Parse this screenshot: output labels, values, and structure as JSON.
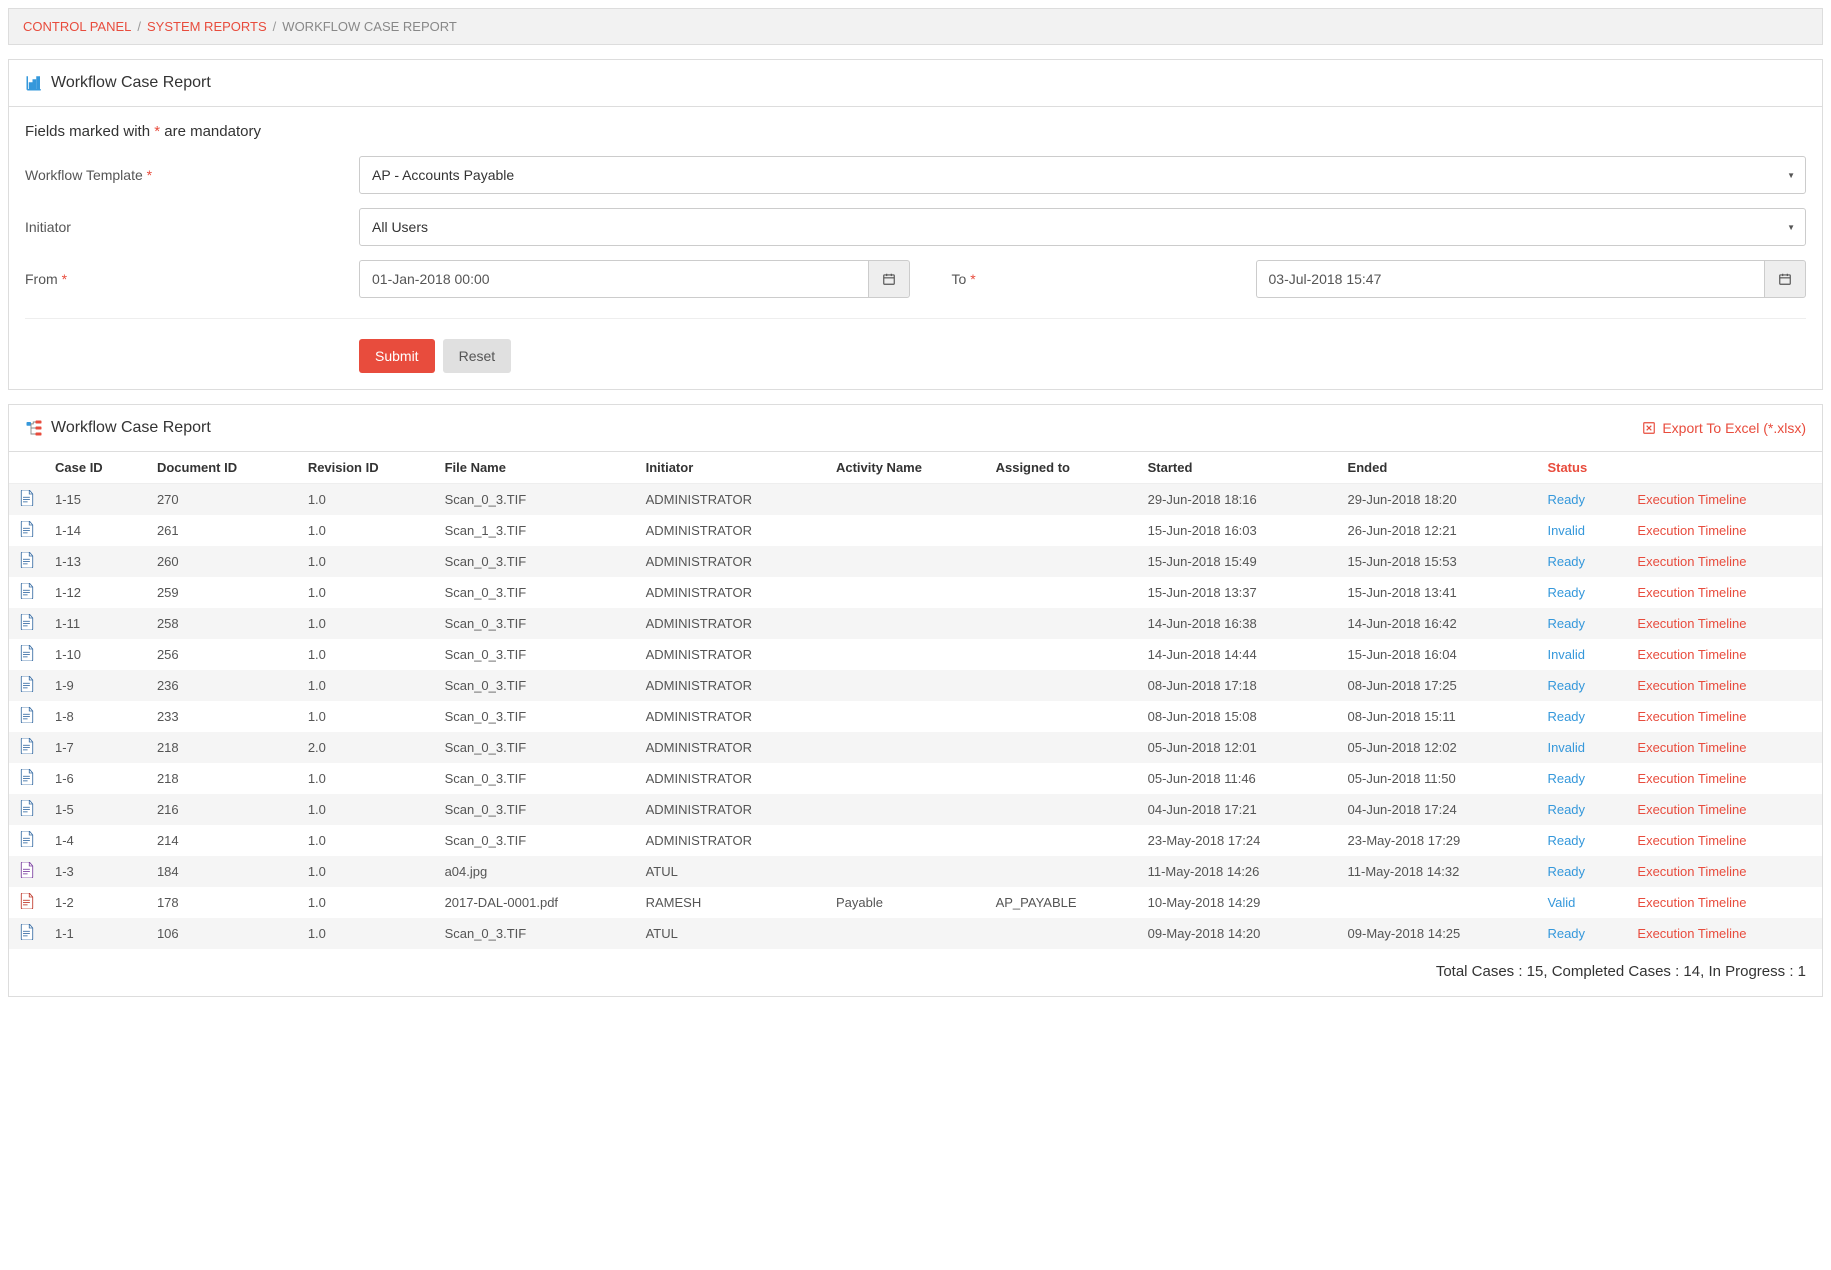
{
  "breadcrumb": {
    "items": [
      {
        "label": "CONTROL PANEL",
        "link": true
      },
      {
        "label": "SYSTEM REPORTS",
        "link": true
      },
      {
        "label": "WORKFLOW CASE REPORT",
        "link": false
      }
    ]
  },
  "form_panel": {
    "title": "Workflow Case Report",
    "mandatory_prefix": "Fields marked with ",
    "mandatory_star": "*",
    "mandatory_suffix": " are mandatory",
    "template_label": "Workflow Template ",
    "template_value": "AP - Accounts Payable",
    "initiator_label": "Initiator",
    "initiator_value": "All Users",
    "from_label": "From ",
    "from_value": "01-Jan-2018 00:00",
    "to_label": "To ",
    "to_value": "03-Jul-2018 15:47",
    "submit": "Submit",
    "reset": "Reset"
  },
  "results_panel": {
    "title": "Workflow Case Report",
    "export_label": "Export To Excel (*.xlsx)",
    "columns": [
      "",
      "Case ID",
      "Document ID",
      "Revision ID",
      "File Name",
      "Initiator",
      "Activity Name",
      "Assigned to",
      "Started",
      "Ended",
      "Status",
      ""
    ],
    "timeline_label": "Execution Timeline",
    "rows": [
      {
        "icon": "doc",
        "case_id": "1-15",
        "doc_id": "270",
        "rev_id": "1.0",
        "file": "Scan_0_3.TIF",
        "initiator": "ADMINISTRATOR",
        "activity": "",
        "assigned": "",
        "started": "29-Jun-2018 18:16",
        "ended": "29-Jun-2018 18:20",
        "status": "Ready"
      },
      {
        "icon": "doc",
        "case_id": "1-14",
        "doc_id": "261",
        "rev_id": "1.0",
        "file": "Scan_1_3.TIF",
        "initiator": "ADMINISTRATOR",
        "activity": "",
        "assigned": "",
        "started": "15-Jun-2018 16:03",
        "ended": "26-Jun-2018 12:21",
        "status": "Invalid"
      },
      {
        "icon": "doc",
        "case_id": "1-13",
        "doc_id": "260",
        "rev_id": "1.0",
        "file": "Scan_0_3.TIF",
        "initiator": "ADMINISTRATOR",
        "activity": "",
        "assigned": "",
        "started": "15-Jun-2018 15:49",
        "ended": "15-Jun-2018 15:53",
        "status": "Ready"
      },
      {
        "icon": "doc",
        "case_id": "1-12",
        "doc_id": "259",
        "rev_id": "1.0",
        "file": "Scan_0_3.TIF",
        "initiator": "ADMINISTRATOR",
        "activity": "",
        "assigned": "",
        "started": "15-Jun-2018 13:37",
        "ended": "15-Jun-2018 13:41",
        "status": "Ready"
      },
      {
        "icon": "doc",
        "case_id": "1-11",
        "doc_id": "258",
        "rev_id": "1.0",
        "file": "Scan_0_3.TIF",
        "initiator": "ADMINISTRATOR",
        "activity": "",
        "assigned": "",
        "started": "14-Jun-2018 16:38",
        "ended": "14-Jun-2018 16:42",
        "status": "Ready"
      },
      {
        "icon": "doc",
        "case_id": "1-10",
        "doc_id": "256",
        "rev_id": "1.0",
        "file": "Scan_0_3.TIF",
        "initiator": "ADMINISTRATOR",
        "activity": "",
        "assigned": "",
        "started": "14-Jun-2018 14:44",
        "ended": "15-Jun-2018 16:04",
        "status": "Invalid"
      },
      {
        "icon": "doc",
        "case_id": "1-9",
        "doc_id": "236",
        "rev_id": "1.0",
        "file": "Scan_0_3.TIF",
        "initiator": "ADMINISTRATOR",
        "activity": "",
        "assigned": "",
        "started": "08-Jun-2018 17:18",
        "ended": "08-Jun-2018 17:25",
        "status": "Ready"
      },
      {
        "icon": "doc",
        "case_id": "1-8",
        "doc_id": "233",
        "rev_id": "1.0",
        "file": "Scan_0_3.TIF",
        "initiator": "ADMINISTRATOR",
        "activity": "",
        "assigned": "",
        "started": "08-Jun-2018 15:08",
        "ended": "08-Jun-2018 15:11",
        "status": "Ready"
      },
      {
        "icon": "doc",
        "case_id": "1-7",
        "doc_id": "218",
        "rev_id": "2.0",
        "file": "Scan_0_3.TIF",
        "initiator": "ADMINISTRATOR",
        "activity": "",
        "assigned": "",
        "started": "05-Jun-2018 12:01",
        "ended": "05-Jun-2018 12:02",
        "status": "Invalid"
      },
      {
        "icon": "doc",
        "case_id": "1-6",
        "doc_id": "218",
        "rev_id": "1.0",
        "file": "Scan_0_3.TIF",
        "initiator": "ADMINISTRATOR",
        "activity": "",
        "assigned": "",
        "started": "05-Jun-2018 11:46",
        "ended": "05-Jun-2018 11:50",
        "status": "Ready"
      },
      {
        "icon": "doc",
        "case_id": "1-5",
        "doc_id": "216",
        "rev_id": "1.0",
        "file": "Scan_0_3.TIF",
        "initiator": "ADMINISTRATOR",
        "activity": "",
        "assigned": "",
        "started": "04-Jun-2018 17:21",
        "ended": "04-Jun-2018 17:24",
        "status": "Ready"
      },
      {
        "icon": "doc",
        "case_id": "1-4",
        "doc_id": "214",
        "rev_id": "1.0",
        "file": "Scan_0_3.TIF",
        "initiator": "ADMINISTRATOR",
        "activity": "",
        "assigned": "",
        "started": "23-May-2018 17:24",
        "ended": "23-May-2018 17:29",
        "status": "Ready"
      },
      {
        "icon": "img",
        "case_id": "1-3",
        "doc_id": "184",
        "rev_id": "1.0",
        "file": "a04.jpg",
        "initiator": "ATUL",
        "activity": "",
        "assigned": "",
        "started": "11-May-2018 14:26",
        "ended": "11-May-2018 14:32",
        "status": "Ready"
      },
      {
        "icon": "pdf",
        "case_id": "1-2",
        "doc_id": "178",
        "rev_id": "1.0",
        "file": "2017-DAL-0001.pdf",
        "initiator": "RAMESH",
        "activity": "Payable",
        "assigned": "AP_PAYABLE",
        "started": "10-May-2018 14:29",
        "ended": "",
        "status": "Valid"
      },
      {
        "icon": "doc",
        "case_id": "1-1",
        "doc_id": "106",
        "rev_id": "1.0",
        "file": "Scan_0_3.TIF",
        "initiator": "ATUL",
        "activity": "",
        "assigned": "",
        "started": "09-May-2018 14:20",
        "ended": "09-May-2018 14:25",
        "status": "Ready"
      }
    ],
    "summary": "Total Cases : 15, Completed Cases : 14, In Progress : 1"
  }
}
